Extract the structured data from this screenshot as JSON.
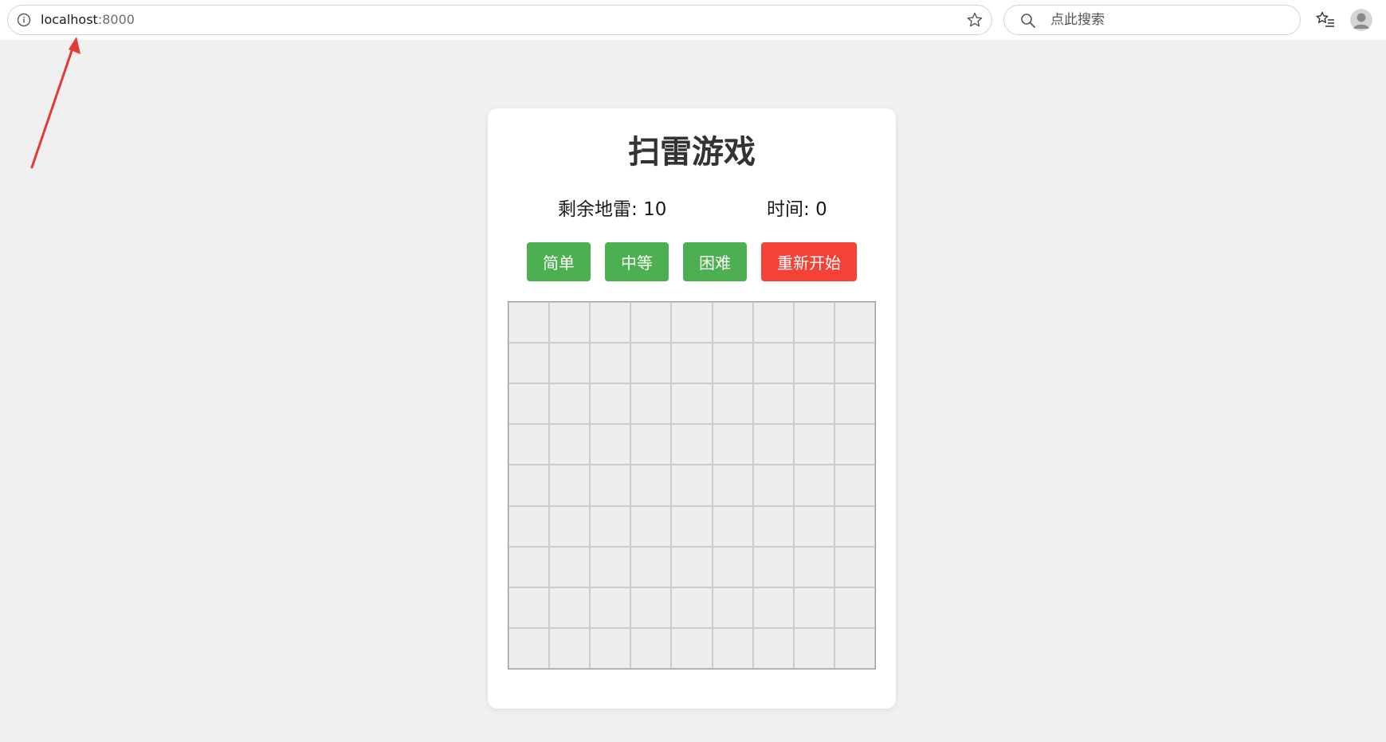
{
  "browser": {
    "url_host": "localhost",
    "url_port": ":8000",
    "search_placeholder": "点此搜索",
    "icons": {
      "info": "info-icon",
      "favorite": "star-icon",
      "search": "search-icon",
      "favorites_list": "favorites-icon",
      "profile": "avatar"
    }
  },
  "game": {
    "title": "扫雷游戏",
    "mines_label": "剩余地雷: ",
    "mines_remaining": "10",
    "time_label": "时间: ",
    "time_value": "0",
    "buttons": {
      "easy": "简单",
      "medium": "中等",
      "hard": "困难",
      "restart": "重新开始"
    },
    "board": {
      "rows": 9,
      "cols": 9,
      "cell_state": "unrevealed"
    }
  },
  "colors": {
    "page_background": "#f0f0f0",
    "card_background": "#ffffff",
    "title_text": "#333333",
    "difficulty_button": "#4caf50",
    "restart_button": "#f44336",
    "cell_fill": "#eeeeee",
    "cell_border": "#cccccc",
    "annotation_arrow": "#e53935"
  }
}
